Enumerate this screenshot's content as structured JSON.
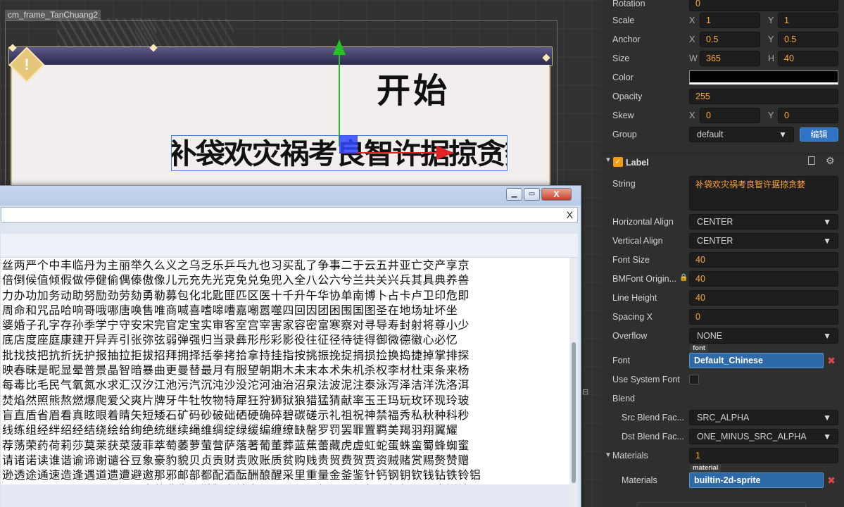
{
  "scene": {
    "node_name": "cm_frame_TanChuang2",
    "title_text": "开始",
    "label_preview_text": "补袋欢灾祸考良智许据掠贪婪",
    "frame_badge": "!"
  },
  "font_window": {
    "restore_label": "▭",
    "minimize_label": "▁",
    "close_label": "X",
    "tab_close_label": "X",
    "lines": [
      "丝两严个中丰临丹为主丽举久么义之乌乏乐乒乓九也习买乱了争事二于云五井亚亡交产享京",
      "倍倒候值倾假做停健偷偶傣傲像儿元充先光克免兑兔兜入全八公六兮兰共关兴兵其具典养兽",
      "力办功加务动助努励劲劳劾勇勒募包化北匙匪匹区医十千升午华协单南博卜占卡卢卫印危即",
      "周命和咒品哈响哥哦哪唐唤售唯商喊喜嗜嗥嘈嘉嘲嚣噬四回因团困围国图圣在地场址坏坐",
      "婆婚子孔字存孙季学宁守安宋完官定宝实审客室宫宰害家容密富寒察对寻导寿封射将尊小少",
      "底店度座庭康建开异弄引张弥弦弱弹强归当录彝形彤彩影役往征径待徒得御微德徽心必忆",
      "批找技把抗折抚护报抽拉拒拔招拜拥择括拳拷拾拿持挂指按挑振挽捉捐损捡换捣捷掉掌排探",
      "映春昧是昵显晕普景晶智暗暴曲更曼替最月有服望朝期木未末本术朱机杀权李材杜束条来杨",
      "每毒比毛民气氧氮水求汇汉汐江池污汽沉沌沙没沱河油治沼泉法波泥注泰泳泻泽洁洋洗洛洱",
      "焚焰然照熊熬燃爆爬爱父爽片牌牙牛牡牧物特犀狂狩狮狱狼猎猛猜献率玉王玛玩玫环现玲玻",
      "盲直盾省眉看真眩眼着睛矢短矮石矿码砂破础硒硬确碎碧碳磋示礼祖祝神禁福秀私秋种科秒",
      "线练组经绊绍经结绕绘给绚绝统继续绳维绸绽绿缓编缠缭缺罄罗罚罢罪置羁美羯羽翔翼耀",
      "荐荡荣药荷莉莎莫莱获菜菠菲萃萄萎萝萤营萨落著葡董葬蓝蕉蕾藏虎虚虹蛇蛋蛛蛮蜀蜂蜘蜜",
      "请诸诺读谁谐谕谛谢谴谷豆象豪豹貌贝贞贡财责败账质贫购贱贵贸费贺贾资贼赌赏赐赘赞赠",
      "逊透途通速造逢遇道遗遭避邀那邪邮部都配酒酝酬酿醒采里重量金釜鉴针钙钢钥钦钱钻铁铃铝",
      "雨雳零雷雾需霆霜霞露霸霹青静非靠面鞋鞭韦韩音顶项顺须顾顿颂预领频题颜额风飞食饼馈"
    ]
  },
  "inspector": {
    "rotation": {
      "label": "Rotation",
      "value": "0"
    },
    "scale": {
      "label": "Scale",
      "x_axis": "X",
      "x": "1",
      "y_axis": "Y",
      "y": "1"
    },
    "anchor": {
      "label": "Anchor",
      "x_axis": "X",
      "x": "0.5",
      "y_axis": "Y",
      "y": "0.5"
    },
    "size": {
      "label": "Size",
      "w_axis": "W",
      "w": "365",
      "h_axis": "H",
      "h": "40"
    },
    "color": {
      "label": "Color",
      "value": "#000000"
    },
    "opacity": {
      "label": "Opacity",
      "value": "255"
    },
    "skew": {
      "label": "Skew",
      "x_axis": "X",
      "x": "0",
      "y_axis": "Y",
      "y": "0"
    },
    "group": {
      "label": "Group",
      "value": "default",
      "edit_button": "编辑"
    },
    "label_component": {
      "title": "Label",
      "string": {
        "label": "String",
        "value": "补袋欢灾祸考良智许据掠贪婪"
      },
      "horizontal_align": {
        "label": "Horizontal Align",
        "value": "CENTER"
      },
      "vertical_align": {
        "label": "Vertical Align",
        "value": "CENTER"
      },
      "font_size": {
        "label": "Font Size",
        "value": "40"
      },
      "bmfont_size": {
        "label": "BMFont Origin...",
        "value": "40"
      },
      "line_height": {
        "label": "Line Height",
        "value": "40"
      },
      "spacing_x": {
        "label": "Spacing X",
        "value": "0"
      },
      "overflow": {
        "label": "Overflow",
        "value": "NONE"
      },
      "font": {
        "label": "Font",
        "tag": "font",
        "value": "Default_Chinese"
      },
      "use_system_font": {
        "label": "Use System Font"
      },
      "blend": {
        "label": "Blend"
      },
      "src_blend": {
        "label": "Src Blend Fac...",
        "value": "SRC_ALPHA"
      },
      "dst_blend": {
        "label": "Dst Blend Fac...",
        "value": "ONE_MINUS_SRC_ALPHA"
      },
      "materials": {
        "label": "Materials",
        "count": "1",
        "item_label": "Materials",
        "tag": "material",
        "value": "builtin-2d-sprite"
      }
    },
    "colors": {
      "accent": "#ffa83a",
      "asset": "#2e6aa8",
      "edit_button": "#2f74c6",
      "checkbox": "#f39c12"
    }
  }
}
